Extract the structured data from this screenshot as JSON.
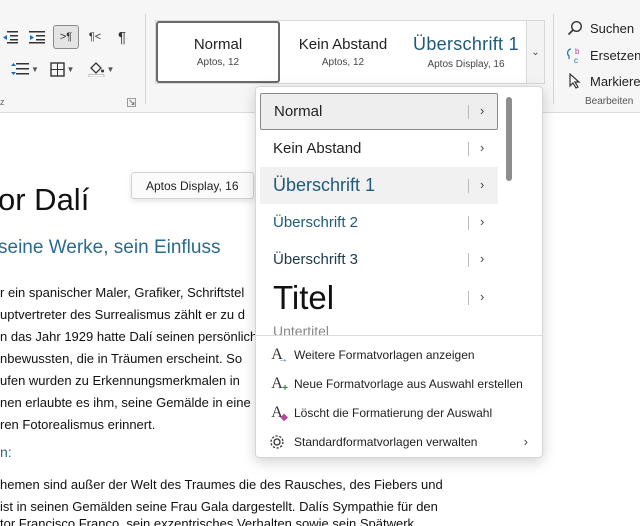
{
  "ribbon": {
    "paragraph_group_label": "z",
    "gallery": [
      {
        "name": "Normal",
        "font": "Aptos, 12"
      },
      {
        "name": "Kein Abstand",
        "font": "Aptos, 12"
      },
      {
        "name": "Überschrift 1",
        "font": "Aptos Display, 16"
      }
    ],
    "editing": {
      "find_label": "Suchen",
      "replace_label": "Ersetzen",
      "select_label": "Markieren",
      "group_label": "Bearbeiten"
    }
  },
  "tooltip": "Aptos Display, 16",
  "dropdown": {
    "styles": [
      "Normal",
      "Kein Abstand",
      "Überschrift 1",
      "Überschrift 2",
      "Überschrift 3",
      "Titel",
      "Untertitel"
    ],
    "actions": [
      "Weitere Formatvorlagen anzeigen",
      "Neue Formatvorlage aus Auswahl erstellen",
      "Löscht die Formatierung der Auswahl",
      "Standardformatvorlagen verwalten"
    ]
  },
  "document": {
    "title": "or Dalí",
    "subtitle": "seine Werke, sein Einfluss",
    "paragraph1": [
      "r ein spanischer Maler, Grafiker, Schriftstel",
      "uptvertreter des Surrealismus zählt er zu d",
      "n das Jahr 1929 hatte Dalí seinen persönlich",
      "nbewussten, die in Träumen erscheint. So",
      "ufen wurden zu Erkennungsmerkmalen in",
      "nen erlaubte es ihm, seine Gemälde in eine",
      "ren Fotorealismus erinnert."
    ],
    "heading": "n:",
    "paragraph2": [
      "hemen sind außer der Welt des Traumes die des Rausches, des Fiebers und",
      "ist in seinen Gemälden seine Frau Gala dargestellt. Dalís Sympathie für den",
      "tor Francisco Franco, sein exzentrisches Verhalten sowie sein Spätwerk"
    ]
  },
  "colors": {
    "heading_blue": "#1e5a7a",
    "ribbon_bg": "#f6f6f6",
    "accent_purple": "#b4479b"
  }
}
